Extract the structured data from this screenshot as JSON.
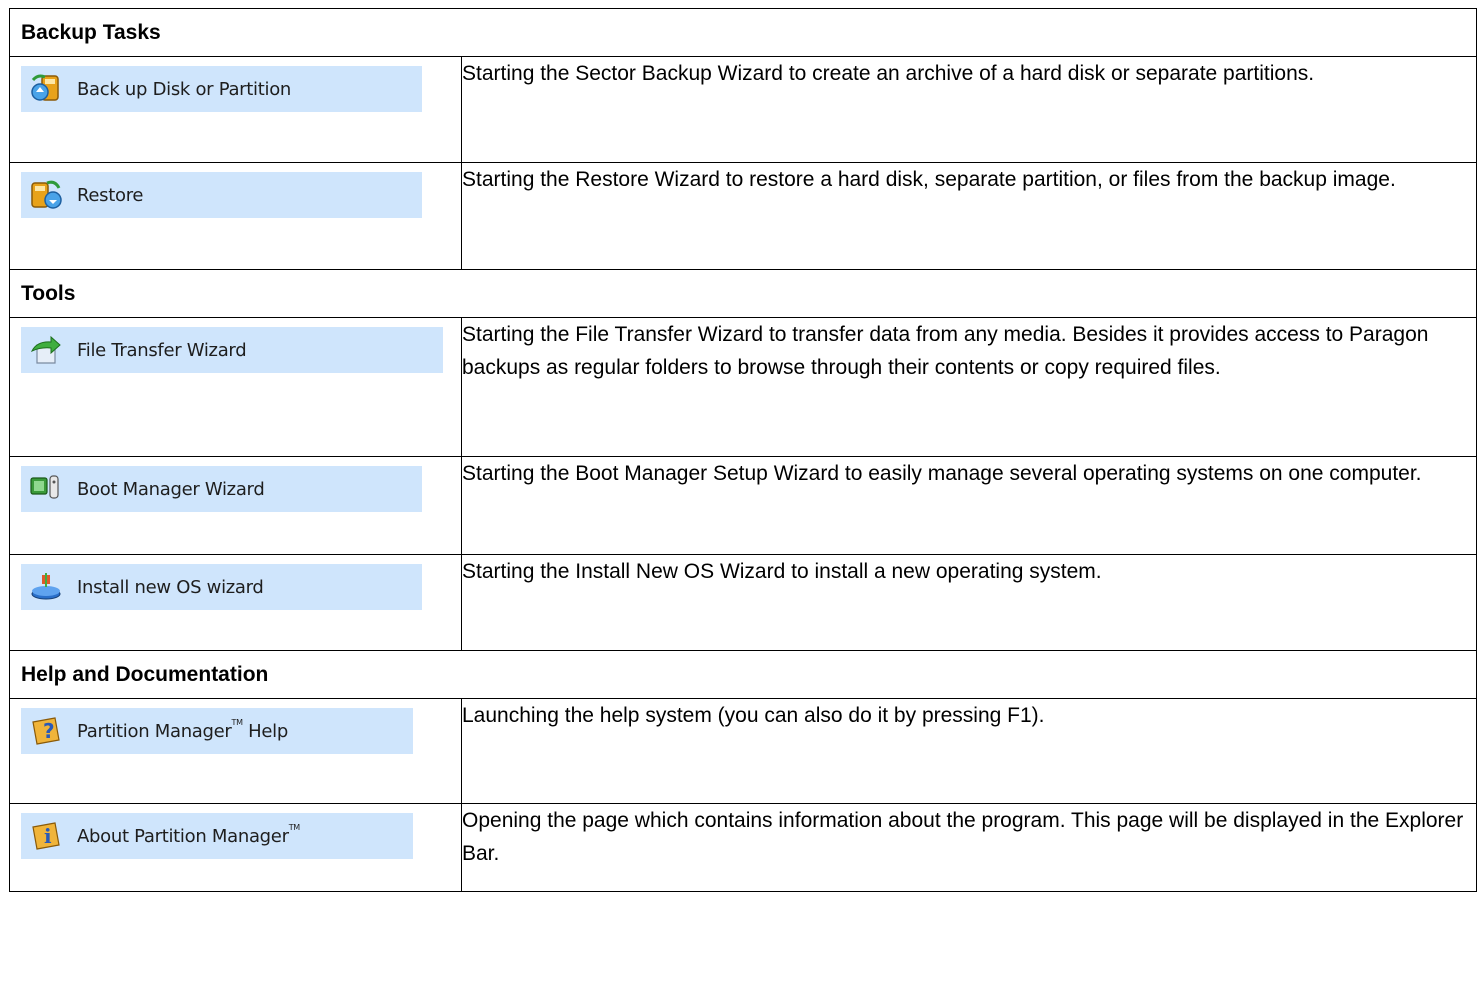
{
  "sections": [
    {
      "title": "Backup Tasks",
      "items": [
        {
          "button_label": "Back up Disk or Partition",
          "icon": "backup-icon",
          "description": "Starting the Sector Backup Wizard to create an archive of a hard disk or separate partitions."
        },
        {
          "button_label": "Restore",
          "icon": "restore-icon",
          "description": "Starting the Restore Wizard to restore a hard disk, separate partition, or files from the backup image."
        }
      ]
    },
    {
      "title": "Tools",
      "items": [
        {
          "button_label": "File Transfer Wizard",
          "icon": "file-transfer-icon",
          "description": "Starting the File Transfer Wizard to transfer data from any media. Besides it provides access to Paragon backups as regular folders to browse through their contents or copy required files."
        },
        {
          "button_label": "Boot Manager Wizard",
          "icon": "boot-manager-icon",
          "description": "Starting the Boot Manager Setup Wizard to easily manage several operating systems on one computer."
        },
        {
          "button_label": "Install new OS wizard",
          "icon": "install-os-icon",
          "description": "Starting the Install New OS Wizard to install a new operating system."
        }
      ]
    },
    {
      "title": "Help and Documentation",
      "items": [
        {
          "button_label": "Partition Manager",
          "trademark": "TM",
          "button_suffix": " Help",
          "icon": "help-icon",
          "description": "Launching the help system (you can also do it by pressing F1)."
        },
        {
          "button_label": "About Partition Manager",
          "trademark": "TM",
          "button_suffix": "",
          "icon": "about-icon",
          "description": "Opening the page which contains information about the program. This page will be displayed in the Explorer Bar."
        }
      ]
    }
  ]
}
